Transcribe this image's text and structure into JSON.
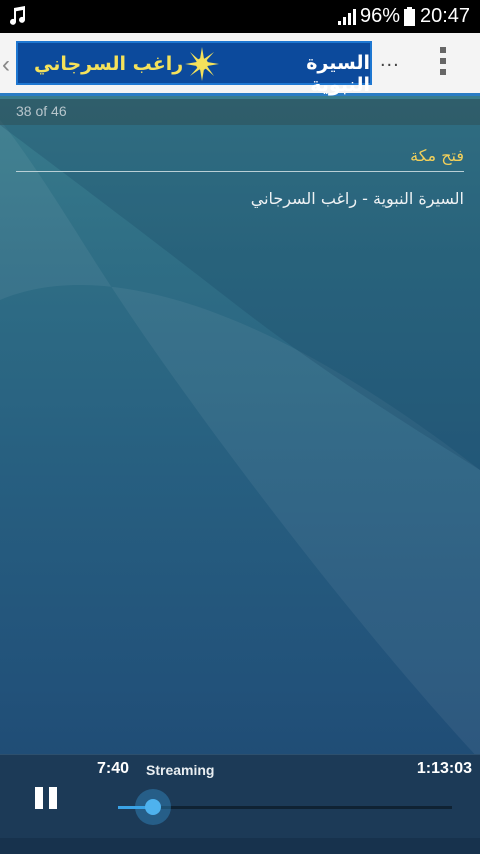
{
  "status_bar": {
    "battery_percent": "96%",
    "clock": "20:47",
    "icons": [
      "music-note-icon",
      "signal-icon",
      "battery-icon"
    ]
  },
  "toolbar": {
    "banner_text_main": "السيرة النبوية",
    "banner_text_author": "راغب السرجاني",
    "overflow_label": "...",
    "icons": [
      "chevron-left-icon",
      "sun-star-icon",
      "more-vert-icon"
    ]
  },
  "counter": {
    "text": "38 of 46"
  },
  "track": {
    "title": "فتح مكة",
    "subtitle": "السيرة النبوية - راغب السرجاني"
  },
  "player": {
    "elapsed": "7:40",
    "status": "Streaming",
    "duration": "1:13:03",
    "progress_fraction": 0.105,
    "icons": [
      "pause-icon"
    ]
  },
  "colors": {
    "title_accent": "#f2d05a",
    "banner_bg": "#0c4a9c",
    "seek_accent": "#3aa3e6"
  }
}
